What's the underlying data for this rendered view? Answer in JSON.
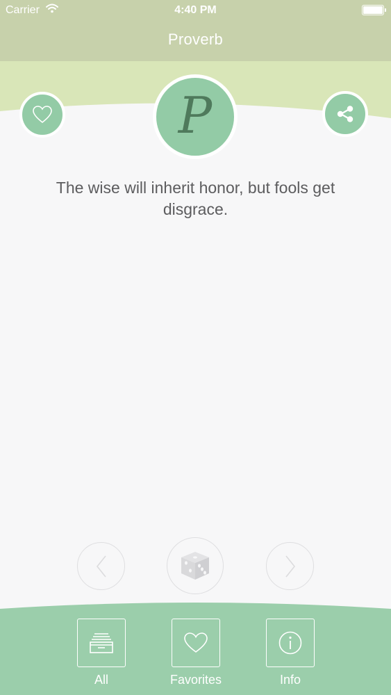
{
  "status_bar": {
    "carrier": "Carrier",
    "time": "4:40 PM"
  },
  "nav": {
    "title": "Proverb"
  },
  "logo": {
    "letter": "P"
  },
  "proverb": {
    "text": "The wise will inherit honor, but fools get disgrace."
  },
  "icons": {
    "favorite": "heart-icon",
    "share": "share-icon",
    "previous": "chevron-left-icon",
    "random": "dice-icon",
    "next": "chevron-right-icon"
  },
  "tabs": [
    {
      "label": "All",
      "icon": "archive-tray-icon"
    },
    {
      "label": "Favorites",
      "icon": "heart-icon"
    },
    {
      "label": "Info",
      "icon": "info-icon"
    }
  ],
  "colors": {
    "nav_bar": "#c7d1ab",
    "header_band": "#d9e6b8",
    "accent_green": "#93cba6",
    "tab_bar": "#9bceab",
    "logo_letter": "#4f7a5c",
    "body_text": "#5c5c5e"
  }
}
